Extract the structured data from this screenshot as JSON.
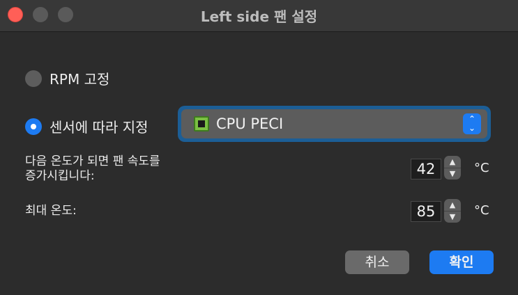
{
  "window": {
    "title": "Left side 팬 설정",
    "close_color": "#ff5f57"
  },
  "mode": {
    "fixed_rpm_label": "RPM 고정",
    "sensor_label": "센서에 따라 지정",
    "selected": "sensor"
  },
  "sensor": {
    "icon": "cpu-chip-icon",
    "value": "CPU PECI"
  },
  "start_temp": {
    "label_line1": "다음 온도가 되면 팬 속도를",
    "label_line2": "증가시킵니다:",
    "value": "42",
    "unit": "°C"
  },
  "max_temp": {
    "label": "최대 온도:",
    "value": "85",
    "unit": "°C"
  },
  "buttons": {
    "cancel": "취소",
    "ok": "확인"
  },
  "colors": {
    "accent": "#1d7bf2",
    "focus_ring": "#1c5e96"
  }
}
